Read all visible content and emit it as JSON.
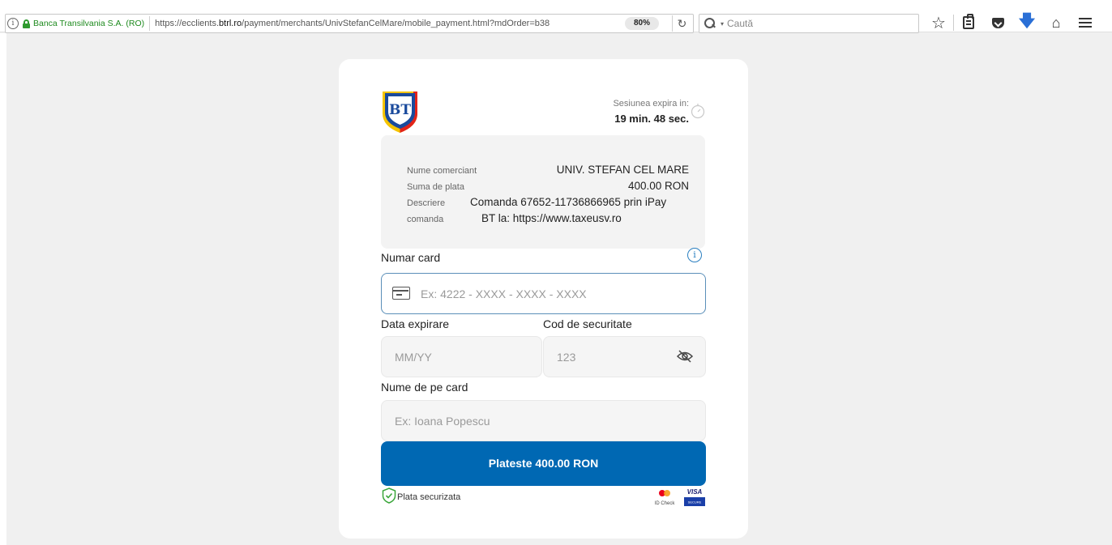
{
  "browser": {
    "site_identity": "Banca Transilvania S.A. (RO)",
    "url_prefix": "https://ecclients.",
    "url_domain": "btrl.ro",
    "url_path": "/payment/merchants/UnivStefanCelMare/mobile_payment.html?mdOrder=b38",
    "zoom": "80%",
    "search_placeholder": "Caută",
    "icons": [
      "info-icon",
      "lock-icon",
      "reload-icon",
      "search-icon",
      "bookmark-star-icon",
      "reading-list-icon",
      "pocket-icon",
      "download-icon",
      "home-icon",
      "menu-icon"
    ]
  },
  "payment": {
    "bank_logo_text": "BT",
    "session_label": "Sesiunea expira in:",
    "session_time": "19 min. 48 sec.",
    "merchant": {
      "name_label": "Nume comerciant",
      "name_value": "UNIV. STEFAN CEL MARE",
      "amount_label": "Suma de plata",
      "amount_value": "400.00 RON",
      "description_label_1": "Descriere",
      "description_label_2": "comanda",
      "description_value_1": "Comanda 67652-11736866965 prin iPay",
      "description_value_2": "BT la: https://www.taxeusv.ro"
    },
    "card_number": {
      "label": "Numar card",
      "value": "",
      "placeholder": "Ex: 4222 - XXXX - XXXX - XXXX"
    },
    "expiry": {
      "label": "Data expirare",
      "value": "",
      "placeholder": "MM/YY"
    },
    "cvv": {
      "label": "Cod de securitate",
      "value": "",
      "placeholder": "123"
    },
    "cardholder": {
      "label": "Nume de pe card",
      "value": "",
      "placeholder": "Ex: Ioana Popescu"
    },
    "pay_button": "Plateste 400.00 RON",
    "secure_text": "Plata securizata",
    "id_check_text": "ID Check",
    "visa_text": "VISA",
    "visa_secure_text": "SECURE",
    "colors": {
      "primary": "#0068b3",
      "logo_blue": "#1a4a9c",
      "logo_yellow": "#f5c400",
      "logo_red": "#e2231a",
      "secure_green": "#3aa63a"
    }
  }
}
